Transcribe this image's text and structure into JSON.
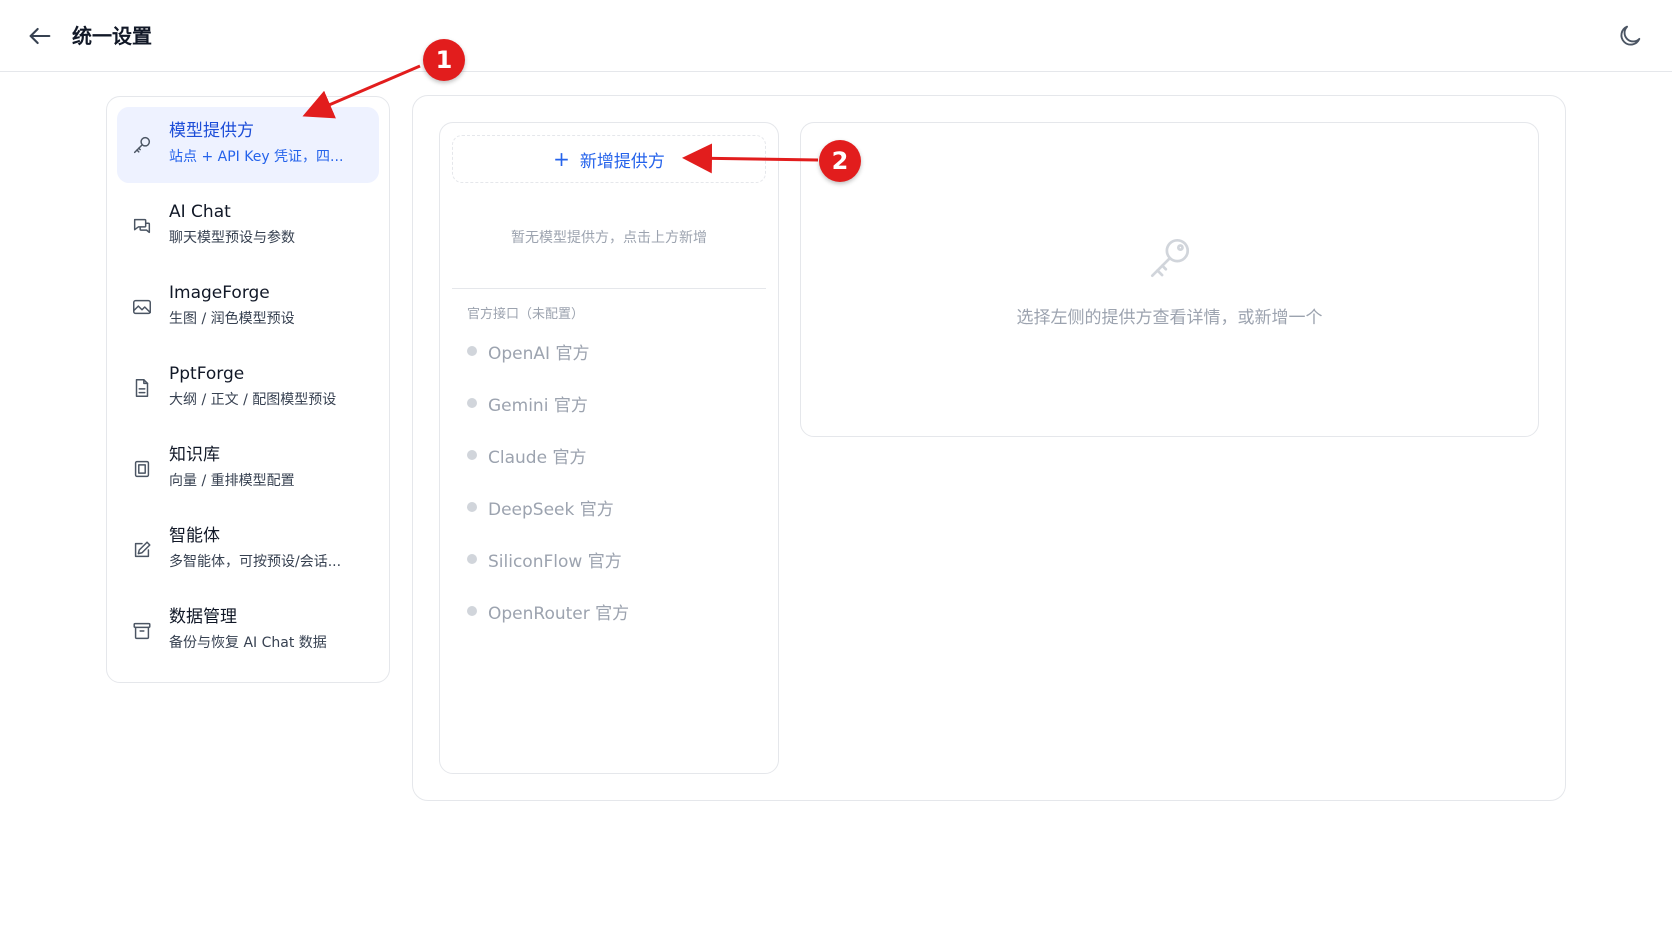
{
  "header": {
    "title": "统一设置",
    "back_icon": "arrow-left-icon",
    "theme_icon": "moon-icon"
  },
  "sidebar": {
    "items": [
      {
        "label": "模型提供方",
        "sub": "站点 + API Key 凭证，四...",
        "icon": "key-icon",
        "active": true
      },
      {
        "label": "AI Chat",
        "sub": "聊天模型预设与参数",
        "icon": "chat-bubbles-icon"
      },
      {
        "label": "ImageForge",
        "sub": "生图 / 润色模型预设",
        "icon": "image-icon"
      },
      {
        "label": "PptForge",
        "sub": "大纲 / 正文 / 配图模型预设",
        "icon": "document-icon"
      },
      {
        "label": "知识库",
        "sub": "向量 / 重排模型配置",
        "icon": "book-icon"
      },
      {
        "label": "智能体",
        "sub": "多智能体，可按预设/会话...",
        "icon": "edit-icon"
      },
      {
        "label": "数据管理",
        "sub": "备份与恢复 AI Chat 数据",
        "icon": "archive-icon"
      }
    ]
  },
  "providers": {
    "add_label": "新增提供方",
    "empty_text": "暂无模型提供方，点击上方新增",
    "section_label": "官方接口（未配置）",
    "official": [
      "OpenAI 官方",
      "Gemini 官方",
      "Claude 官方",
      "DeepSeek 官方",
      "SiliconFlow 官方",
      "OpenRouter 官方"
    ]
  },
  "detail": {
    "icon": "key-icon",
    "placeholder": "选择左侧的提供方查看详情，或新增一个"
  },
  "annotations": {
    "markers": [
      "1",
      "2"
    ],
    "color": "#e21d1d"
  },
  "colors": {
    "accent": "#2563eb",
    "active_bg": "#eef2ff"
  }
}
